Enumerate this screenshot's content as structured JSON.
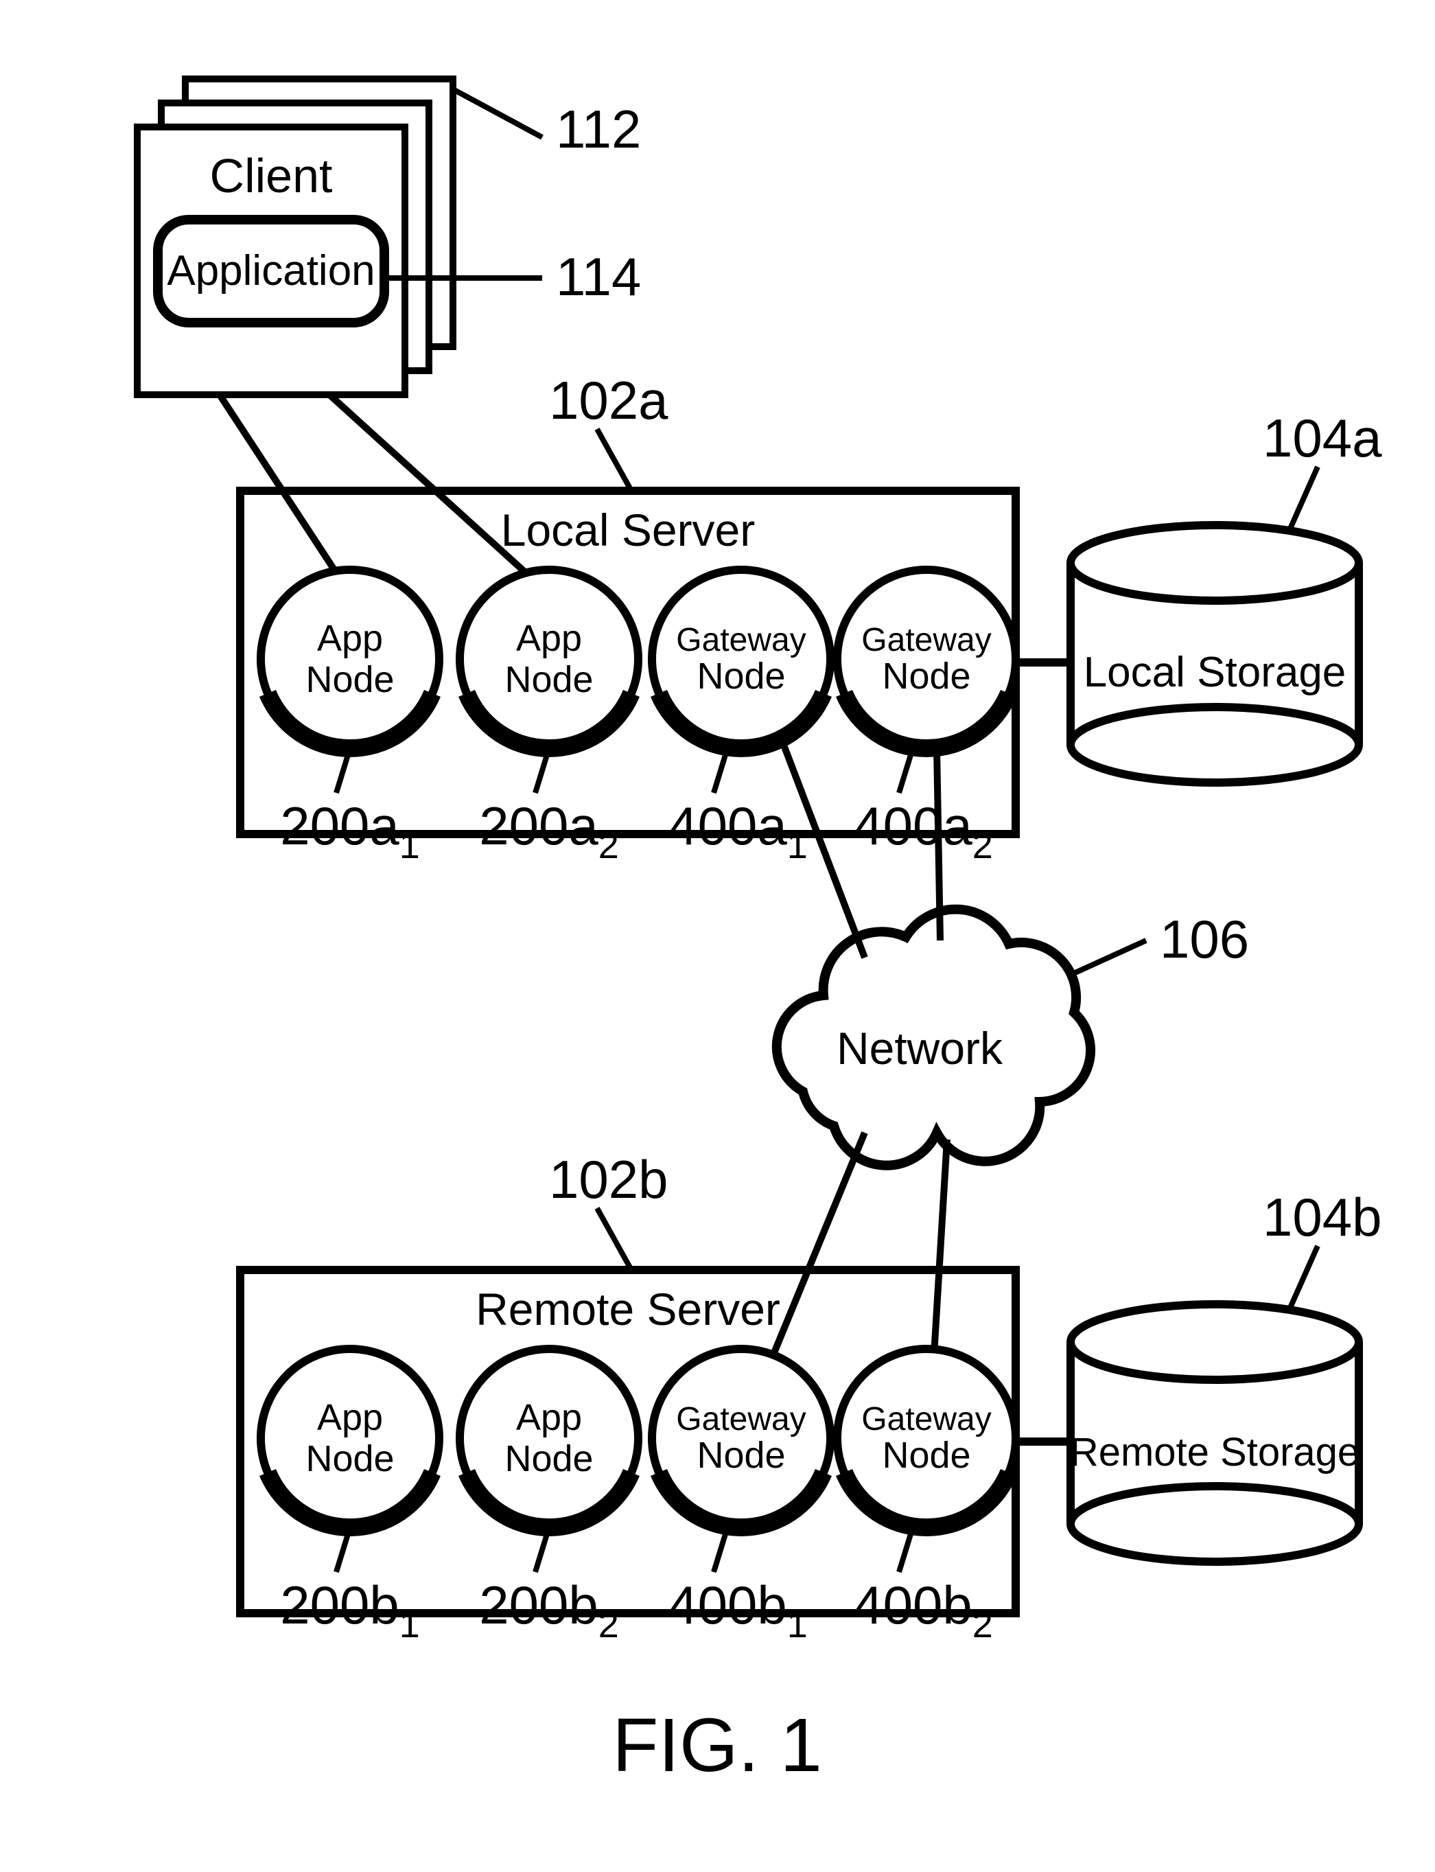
{
  "figure_label": "FIG. 1",
  "client": {
    "title": "Client",
    "ref": "112",
    "app_label": "Application",
    "app_ref": "114"
  },
  "local_server": {
    "title": "Local Server",
    "ref": "102a",
    "nodes": [
      {
        "label_line1": "App",
        "label_line2": "Node",
        "ref_base": "200a",
        "ref_sub": "1"
      },
      {
        "label_line1": "App",
        "label_line2": "Node",
        "ref_base": "200a",
        "ref_sub": "2"
      },
      {
        "label_line1": "Gateway",
        "label_line2": "Node",
        "ref_base": "400a",
        "ref_sub": "1"
      },
      {
        "label_line1": "Gateway",
        "label_line2": "Node",
        "ref_base": "400a",
        "ref_sub": "2"
      }
    ]
  },
  "local_storage": {
    "title": "Local Storage",
    "ref": "104a"
  },
  "network": {
    "title": "Network",
    "ref": "106"
  },
  "remote_server": {
    "title": "Remote Server",
    "ref": "102b",
    "nodes": [
      {
        "label_line1": "App",
        "label_line2": "Node",
        "ref_base": "200b",
        "ref_sub": "1"
      },
      {
        "label_line1": "App",
        "label_line2": "Node",
        "ref_base": "200b",
        "ref_sub": "2"
      },
      {
        "label_line1": "Gateway",
        "label_line2": "Node",
        "ref_base": "400b",
        "ref_sub": "1"
      },
      {
        "label_line1": "Gateway",
        "label_line2": "Node",
        "ref_base": "400b",
        "ref_sub": "2"
      }
    ]
  },
  "remote_storage": {
    "title": "Remote Storage",
    "ref": "104b"
  }
}
